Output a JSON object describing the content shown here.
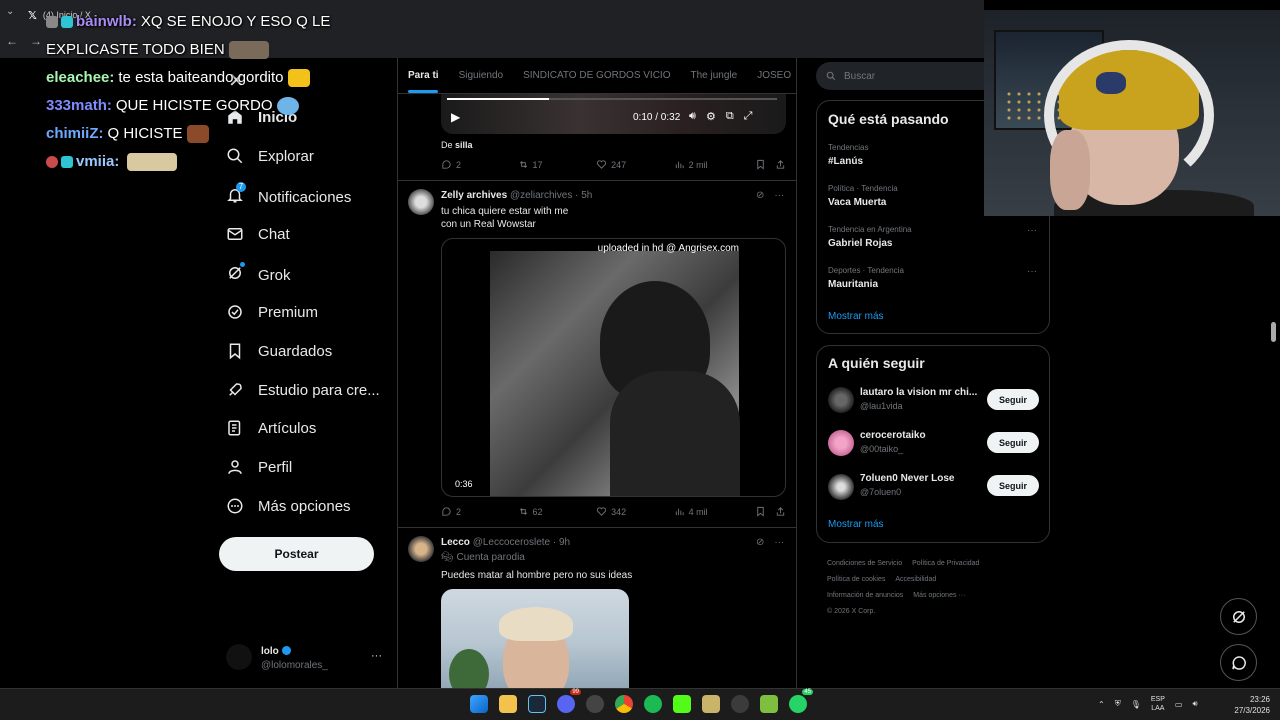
{
  "browser": {
    "tab_title": "(4) Inicio / X",
    "nav_back": "←",
    "nav_forward": "→"
  },
  "chat": [
    {
      "user": "bainwlb",
      "sep": ":",
      "message": "XQ SE ENOJO Y ESO Q LE",
      "color": "#a98cf5"
    },
    {
      "user": "",
      "sep": "",
      "message": "EXPLICASTE TODO BIEN",
      "color": "#ffffff"
    },
    {
      "user": "eleachee",
      "sep": ":",
      "message": "te esta baiteando gordito",
      "color": "#a8f5b0"
    },
    {
      "user": "333math",
      "sep": ":",
      "message": "QUE HICISTE GORDO",
      "color": "#7f8cff"
    },
    {
      "user": "chimiiZ",
      "sep": ":",
      "message": "Q HICISTE",
      "color": "#6fa8ff"
    },
    {
      "user": "vmiia",
      "sep": ":",
      "message": "",
      "color": "#9bc8ff"
    }
  ],
  "leftnav": {
    "close": "✕",
    "items": [
      {
        "label": "Inicio",
        "icon": "home-icon"
      },
      {
        "label": "Explorar",
        "icon": "search-icon"
      },
      {
        "label": "Notificaciones",
        "icon": "bell-icon",
        "badge": "7"
      },
      {
        "label": "Chat",
        "icon": "mail-icon"
      },
      {
        "label": "Grok",
        "icon": "grok-icon"
      },
      {
        "label": "Premium",
        "icon": "verified-icon"
      },
      {
        "label": "Guardados",
        "icon": "bookmark-icon"
      },
      {
        "label": "Estudio para cre...",
        "icon": "rocket-icon"
      },
      {
        "label": "Artículos",
        "icon": "article-icon"
      },
      {
        "label": "Perfil",
        "icon": "person-icon"
      },
      {
        "label": "Más opciones",
        "icon": "more-circle-icon"
      }
    ],
    "post_button": "Postear",
    "account": {
      "name": "lolo",
      "handle": "@lolomorales_",
      "more": "···"
    }
  },
  "tabs": [
    "Para ti",
    "Siguiendo",
    "SINDICATO DE GORDOS VICIO",
    "The jungle",
    "JOSEO"
  ],
  "feed": {
    "video1": {
      "time": "0:10 / 0:32",
      "caption_prefix": "De",
      "caption_word": "silla",
      "progress": 0.31
    },
    "stats1": {
      "replies": "2",
      "reposts": "17",
      "likes": "247",
      "views": "2 mil"
    },
    "tweet2": {
      "name": "Zelly archives",
      "handle": "@zeliarchives · 5h",
      "line1": "tu chica quiere estar with me",
      "line2": "con un Real Wowstar",
      "watermark": "uploaded in hd @  Angrisex.com",
      "duration": "0:36",
      "stats": {
        "replies": "2",
        "reposts": "62",
        "likes": "342",
        "views": "4 mil"
      }
    },
    "tweet3": {
      "name": "Lecco",
      "handle": "@Leccoceroslete · 9h",
      "parody": "Cuenta parodia",
      "text": "Puedes matar al hombre pero no sus ideas"
    },
    "more": "···"
  },
  "right": {
    "search_placeholder": "Buscar",
    "trends_title": "Qué está pasando",
    "trends": [
      {
        "category": "Tendencias",
        "name": "#Lanús"
      },
      {
        "category": "Política · Tendencia",
        "name": "Vaca Muerta"
      },
      {
        "category": "Tendencia en Argentina",
        "name": "Gabriel Rojas"
      },
      {
        "category": "Deportes · Tendencia",
        "name": "Mauritania"
      }
    ],
    "show_more": "Mostrar más",
    "follow_title": "A quién seguir",
    "follow": [
      {
        "name": "lautaro la vision mr chi...",
        "handle": "@lau1vida",
        "button": "Seguir"
      },
      {
        "name": "cerocerotaiko",
        "handle": "@00taiko_",
        "button": "Seguir"
      },
      {
        "name": "7oluen0 Never Lose",
        "handle": "@7oluen0",
        "button": "Seguir"
      }
    ],
    "footer": [
      "Condiciones de Servicio",
      "Política de Privacidad",
      "Política de cookies",
      "Accesibilidad",
      "Información de anuncios",
      "Más opciones ···",
      "© 2026 X Corp."
    ]
  },
  "taskbar": {
    "lang_top": "ESP",
    "lang_bottom": "LAA",
    "time": "23:26",
    "date": "27/3/2026",
    "discord_badge": "99",
    "whatsapp_badge": "45"
  }
}
